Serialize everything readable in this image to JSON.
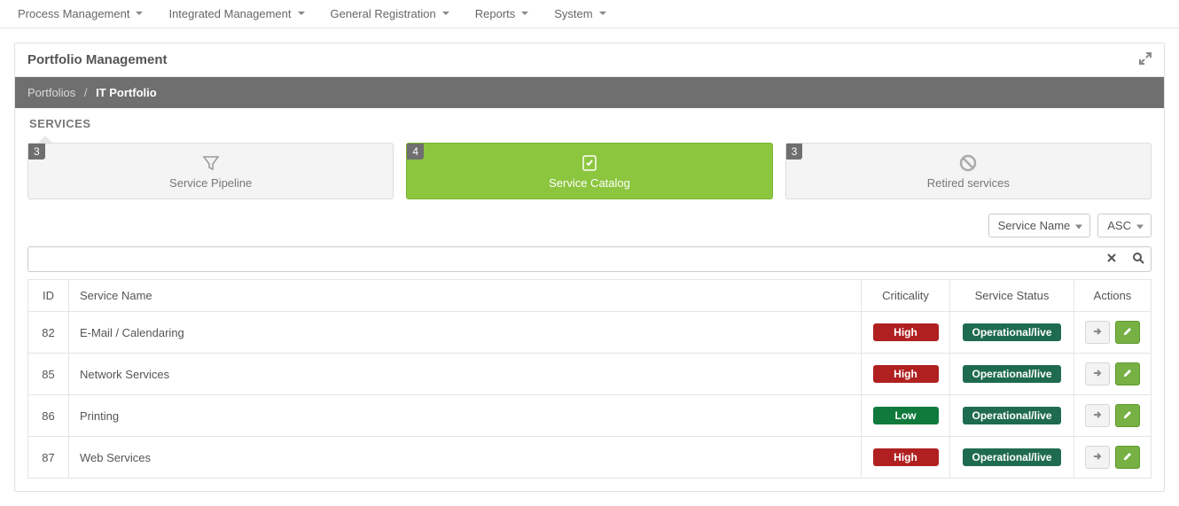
{
  "topmenu": [
    {
      "label": "Process Management"
    },
    {
      "label": "Integrated Management"
    },
    {
      "label": "General Registration"
    },
    {
      "label": "Reports"
    },
    {
      "label": "System"
    }
  ],
  "panel": {
    "title": "Portfolio Management"
  },
  "breadcrumb": {
    "parent": "Portfolios",
    "separator": "/",
    "current": "IT Portfolio"
  },
  "section_heading": "SERVICES",
  "cards": [
    {
      "badge": "3",
      "label": "Service Pipeline",
      "active": false,
      "icon": "funnel"
    },
    {
      "badge": "4",
      "label": "Service Catalog",
      "active": true,
      "icon": "check-doc"
    },
    {
      "badge": "3",
      "label": "Retired services",
      "active": false,
      "icon": "ban"
    }
  ],
  "sort": {
    "field": "Service Name",
    "order": "ASC"
  },
  "search": {
    "value": ""
  },
  "table": {
    "headers": {
      "id": "ID",
      "name": "Service Name",
      "criticality": "Criticality",
      "status": "Service Status",
      "actions": "Actions"
    },
    "rows": [
      {
        "id": "82",
        "name": "E-Mail / Calendaring",
        "criticality": "High",
        "crit_level": "red",
        "status": "Operational/live"
      },
      {
        "id": "85",
        "name": "Network Services",
        "criticality": "High",
        "crit_level": "red",
        "status": "Operational/live"
      },
      {
        "id": "86",
        "name": "Printing",
        "criticality": "Low",
        "crit_level": "green",
        "status": "Operational/live"
      },
      {
        "id": "87",
        "name": "Web Services",
        "criticality": "High",
        "crit_level": "red",
        "status": "Operational/live"
      }
    ]
  }
}
